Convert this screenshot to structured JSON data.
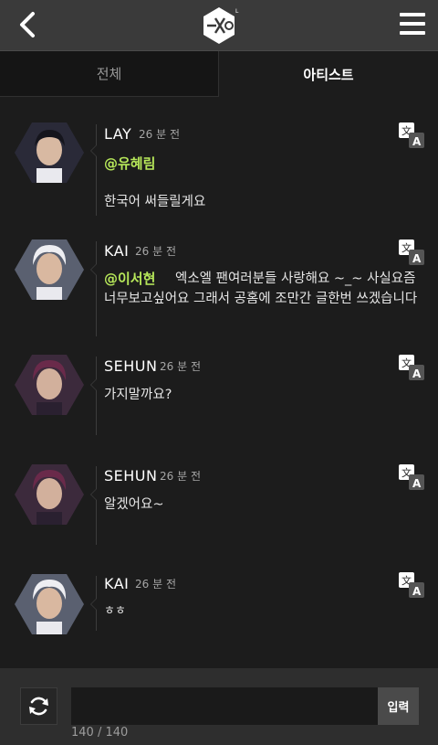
{
  "header": {
    "back_icon": "chevron-left-icon",
    "logo": "exo-logo",
    "menu_icon": "hamburger-menu-icon"
  },
  "tabs": [
    {
      "label": "전체",
      "active": false
    },
    {
      "label": "아티스트",
      "active": true
    }
  ],
  "posts": [
    {
      "name": "LAY",
      "time": "26 분 전",
      "mention": "@유혜림",
      "message": "한국어 써들릴게요",
      "avatar_color": "#3a3a4a"
    },
    {
      "name": "KAI",
      "time": "26 분 전",
      "mention": "@이서현",
      "message": "엑소엘 팬여러분들 사랑해요 ~_~ 사실요즘 너무보고싶어요 그래서 공홈에 조만간 글한번 쓰겠습니다",
      "avatar_color": "#c9c9d0"
    },
    {
      "name": "SEHUN",
      "time": "26 분 전",
      "mention": "",
      "message": "가지말까요?",
      "avatar_color": "#5a3550"
    },
    {
      "name": "SEHUN",
      "time": "26 분 전",
      "mention": "",
      "message": "알겠어요~",
      "avatar_color": "#5a3550"
    },
    {
      "name": "KAI",
      "time": "26 분 전",
      "mention": "",
      "message": "ㅎㅎ",
      "avatar_color": "#c9c9d0"
    }
  ],
  "composer": {
    "refresh_icon": "refresh-icon",
    "input_value": "",
    "submit_label": "입력",
    "counter": "140 / 140"
  },
  "colors": {
    "mention": "#b7e85a",
    "background": "#1c1c1c",
    "topbar": "#3a3a3a"
  }
}
